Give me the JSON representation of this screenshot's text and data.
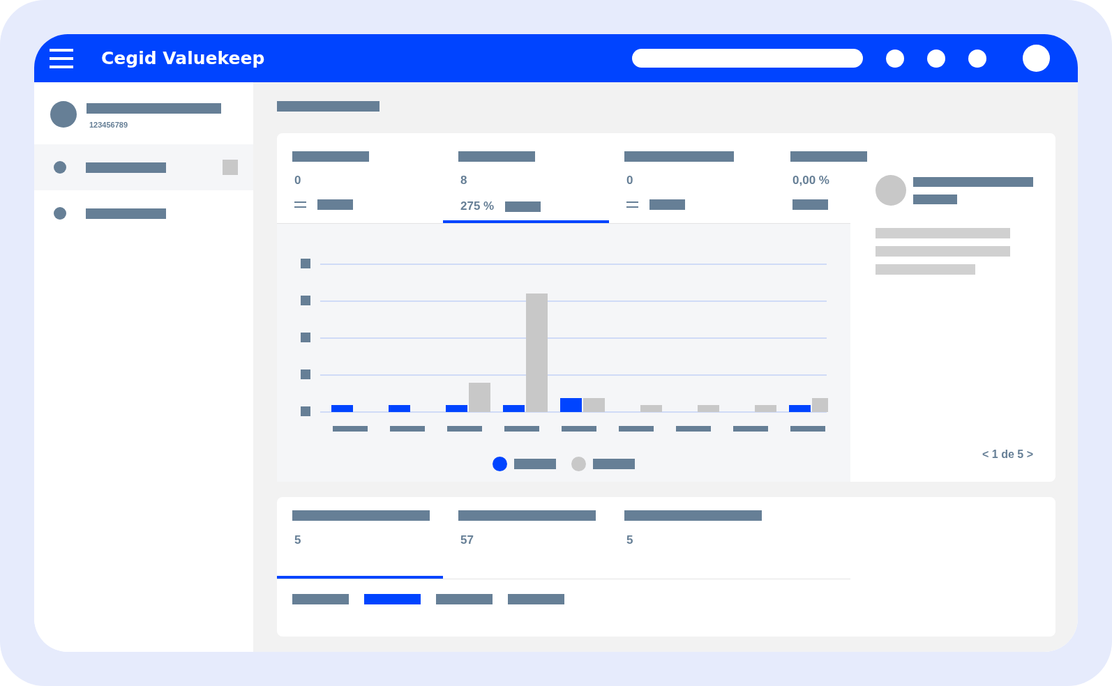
{
  "app": {
    "title": "Cegid Valuekeep"
  },
  "sidebar": {
    "account_number": "123456789",
    "items": [
      {
        "selected": true
      },
      {
        "selected": false
      }
    ]
  },
  "kpis": [
    {
      "value": "0",
      "kind": "flat",
      "selected": false
    },
    {
      "value": "8",
      "kind": "percent",
      "change": "275 %",
      "selected": true
    },
    {
      "value": "0",
      "kind": "flat",
      "selected": false
    },
    {
      "value": "0,00 %",
      "kind": "plain",
      "selected": false
    }
  ],
  "pager": "< 1 de 5 >",
  "bottom_tabs": [
    {
      "value": "5",
      "selected": true
    },
    {
      "value": "57",
      "selected": false
    },
    {
      "value": "5",
      "selected": false
    }
  ],
  "sub_tabs": [
    {
      "selected": false
    },
    {
      "selected": true
    },
    {
      "selected": false
    },
    {
      "selected": false
    }
  ]
}
